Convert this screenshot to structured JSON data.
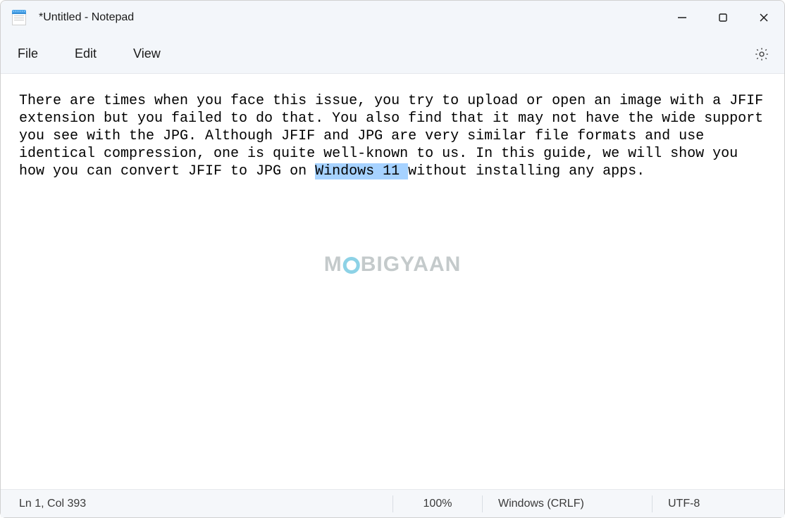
{
  "title": "*Untitled - Notepad",
  "menu": {
    "file": "File",
    "edit": "Edit",
    "view": "View"
  },
  "editor": {
    "text_before_selection": "There are times when you face this issue, you try to upload or open an image with a JFIF extension but you failed to do that. You also find that it may not have the wide support you see with the JPG. Although JFIF and JPG are very similar file formats and use identical compression, one is quite well-known to us. In this guide, we will show you how you can convert JFIF to JPG on ",
    "selection": "Windows 11 ",
    "text_after_selection": "without installing any apps."
  },
  "watermark": {
    "left": "M",
    "right": "BIGYAAN"
  },
  "status": {
    "position": "Ln 1, Col 393",
    "zoom": "100%",
    "line_ending": "Windows (CRLF)",
    "encoding": "UTF-8"
  },
  "icons": {
    "minimize": "minimize-icon",
    "maximize": "maximize-icon",
    "close": "close-icon",
    "settings": "gear-icon",
    "app": "notepad-icon"
  }
}
